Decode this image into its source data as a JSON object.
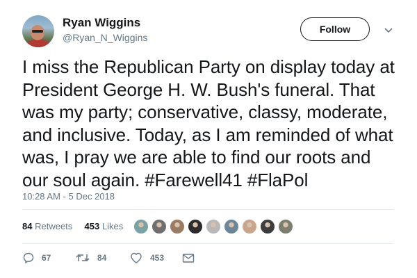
{
  "user": {
    "name": "Ryan Wiggins",
    "handle": "@Ryan_N_Wiggins"
  },
  "follow_label": "Follow",
  "tweet": {
    "text": "I miss the Republican Party on display today at President George H. W. Bush's funeral. That was my party; conservative, classy, moderate, and inclusive. Today, as I am reminded of what was, I pray we are able to find our roots and our soul again. #Farewell41 #FlaPol"
  },
  "timestamp": "10:28 AM - 5 Dec 2018",
  "stats": {
    "retweets_count": "84",
    "retweets_label": "Retweets",
    "likes_count": "453",
    "likes_label": "Likes"
  },
  "liker_avatar_colors": [
    "#7aa3a6",
    "#6f6f6f",
    "#9a7b64",
    "#2b2b2b",
    "#b9b9b9",
    "#6b8799",
    "#c9a58c",
    "#3d3d3d",
    "#7e7e6e"
  ],
  "actions": {
    "replies": "67",
    "retweets": "84",
    "likes": "453"
  },
  "icons": [
    "reply-icon",
    "retweet-icon",
    "like-icon",
    "message-icon",
    "chevron-down-icon"
  ]
}
